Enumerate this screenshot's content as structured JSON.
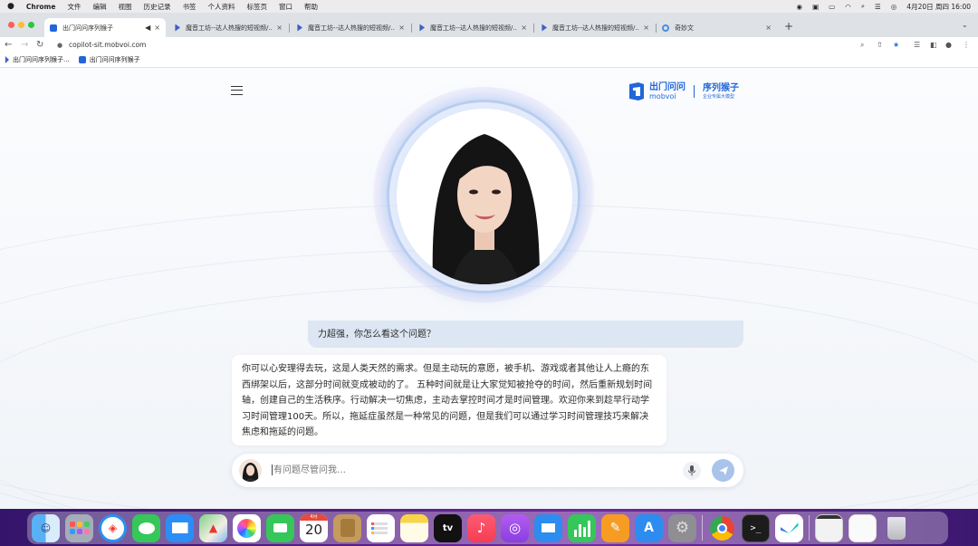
{
  "menubar": {
    "app": "Chrome",
    "items": [
      "文件",
      "编辑",
      "视图",
      "历史记录",
      "书签",
      "个人资料",
      "标签页",
      "窗口",
      "帮助"
    ],
    "datetime": "4月20日 周四 16:00"
  },
  "tabs": [
    {
      "title": "出门问问序列猴子",
      "active": true
    },
    {
      "title": "魔音工坊--达人热搜的短视频/..."
    },
    {
      "title": "魔音工坊--达人热搜的短视频/..."
    },
    {
      "title": "魔音工坊--达人热搜的短视频/..."
    },
    {
      "title": "魔音工坊--达人热搜的短视频/..."
    },
    {
      "title": "奇妙文"
    }
  ],
  "new_tab": "+",
  "address": "copilot-sit.mobvoi.com",
  "bookmarks": [
    "出门问问序列猴子...",
    "出门问问序列猴子"
  ],
  "logo": {
    "cn": "出门问问",
    "en": "mobvoi",
    "product": "序列猴子",
    "tagline": "企业专属大模型"
  },
  "chat": {
    "question": "力超强，你怎么看这个问题？",
    "answer": "你可以心安理得去玩，这是人类天然的需求。但是主动玩的意愿，被手机、游戏或者其他让人上瘾的东西绑架以后，这部分时间就变成被动的了。 五种时间就是让大家觉知被抢夺的时间，然后重新规划时间轴，创建自己的生活秩序。行动解决一切焦虑，主动去掌控时间才是时间管理。欢迎你来到趁早行动学习时间管理100天。所以，拖延症虽然是一种常见的问题，但是我们可以通过学习时间管理技巧来解决焦虑和拖延的问题。"
  },
  "input": {
    "placeholder": "有问题尽管问我…"
  },
  "dock": {
    "calendar_month": "4月",
    "calendar_day": "20",
    "tv_label": "tv"
  },
  "colors": {
    "accent": "#2266d8",
    "question_bg": "#dde7f3",
    "send": "#a9c3ea"
  }
}
